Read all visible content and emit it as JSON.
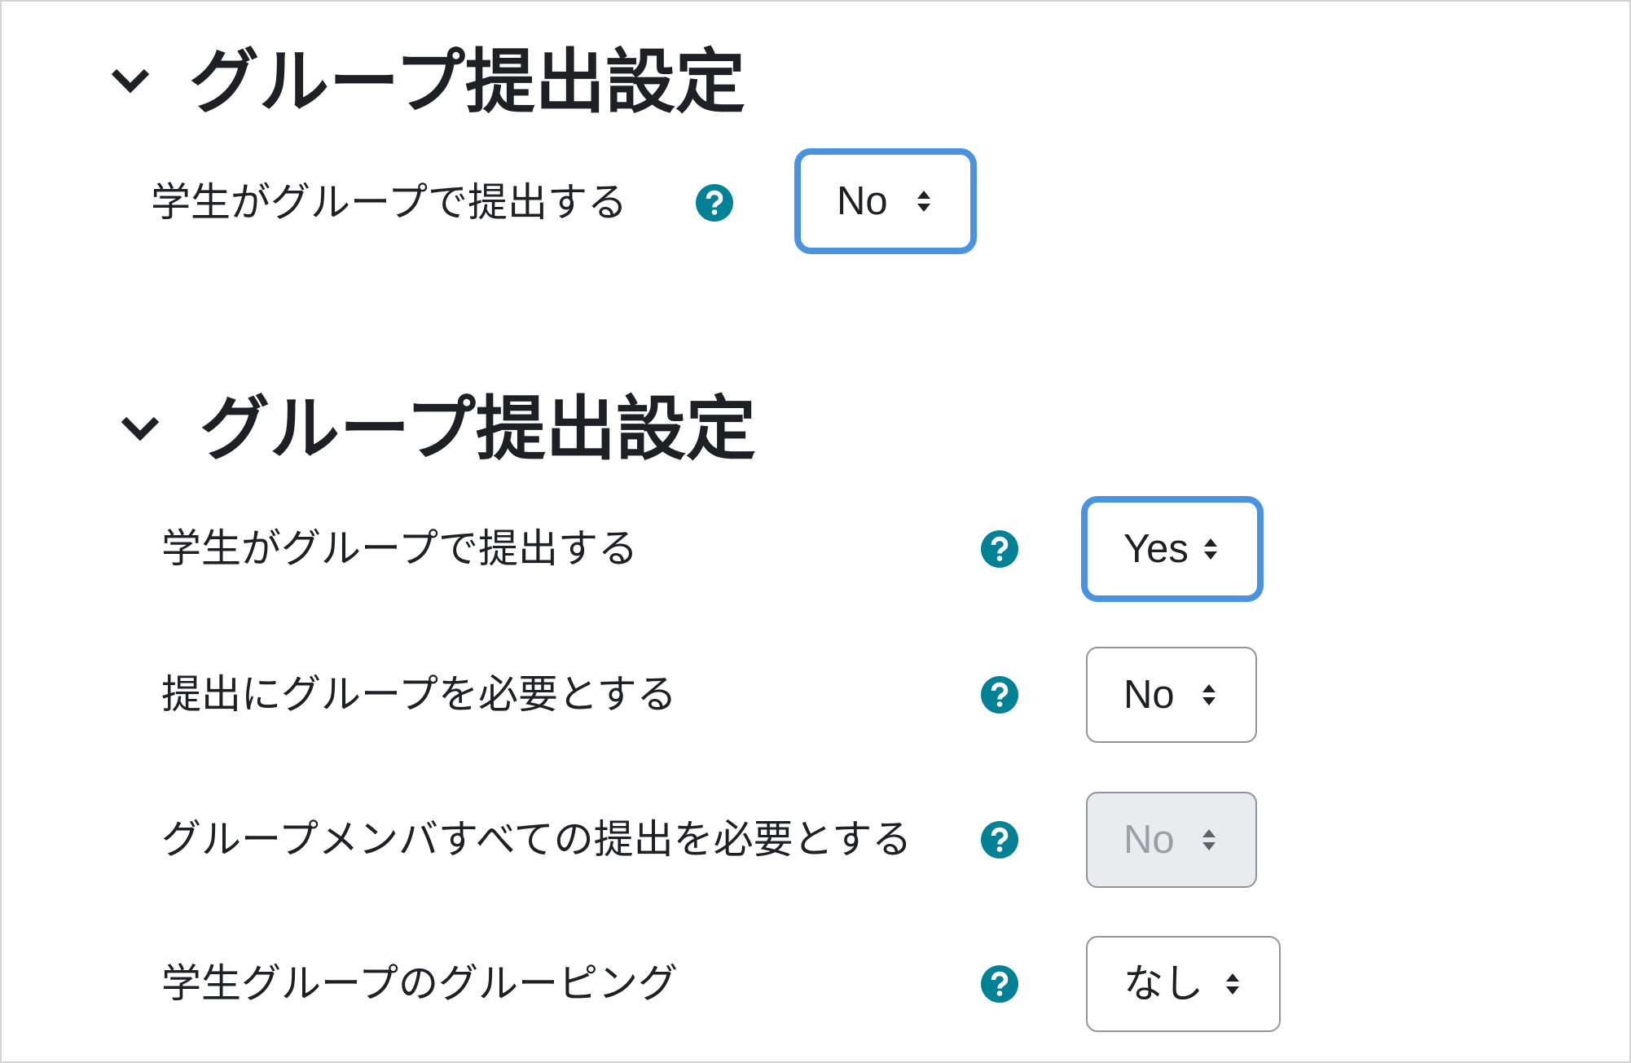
{
  "colors": {
    "text": "#1d2125",
    "help_icon": "#008196",
    "focus_ring": "#4b93dc",
    "select_border": "#8f959e",
    "disabled_bg": "#e9ecef",
    "disabled_text": "#9aa0a6",
    "page_border": "#d4d4d4"
  },
  "icons": {
    "section_toggle": "chevron-down-icon",
    "help": "question-circle-icon",
    "select_arrows": "sort-arrows-icon"
  },
  "sections": [
    {
      "title": "グループ提出設定",
      "expanded": true,
      "fields": [
        {
          "label": "学生がグループで提出する",
          "value": "No",
          "focused": true,
          "disabled": false
        }
      ]
    },
    {
      "title": "グループ提出設定",
      "expanded": true,
      "fields": [
        {
          "label": "学生がグループで提出する",
          "value": "Yes",
          "focused": true,
          "disabled": false
        },
        {
          "label": "提出にグループを必要とする",
          "value": "No",
          "focused": false,
          "disabled": false
        },
        {
          "label": "グループメンバすべての提出を必要とする",
          "value": "No",
          "focused": false,
          "disabled": true
        },
        {
          "label": "学生グループのグルーピング",
          "value": "なし",
          "focused": false,
          "disabled": false
        }
      ]
    }
  ]
}
